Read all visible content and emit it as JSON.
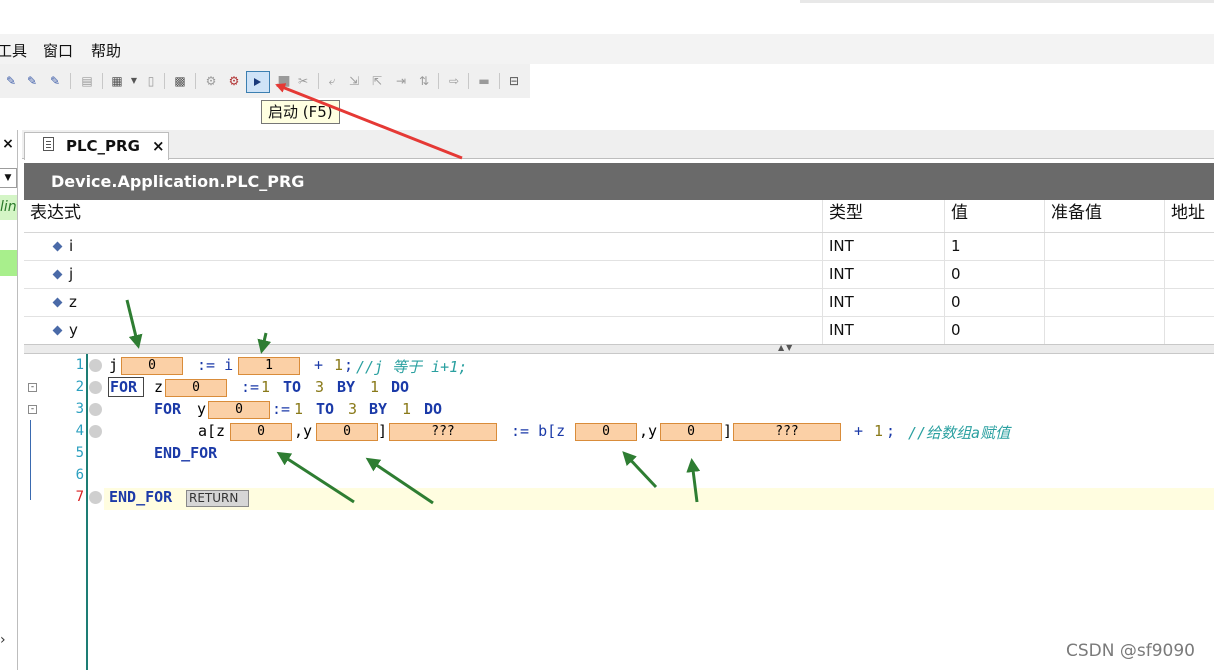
{
  "menu": {
    "tools": "工具",
    "window": "窗口",
    "help": "帮助"
  },
  "toolbar": {
    "run_tooltip": "启动 (F5)",
    "icons": [
      "login-icon",
      "logout-icon",
      "online-icon",
      "copy-icon",
      "add-device-icon",
      "paste-icon",
      "screenshot-icon",
      "build-icon",
      "rebuild-icon",
      "run-icon",
      "stop-icon",
      "reset-icon",
      "step-over-icon",
      "step-into-icon",
      "step-out-icon",
      "run-to-cursor-icon",
      "set-next-icon",
      "show-next-icon",
      "write-values-icon",
      "force-values-icon"
    ]
  },
  "left_panel": {
    "close": "×",
    "green_text": "lin",
    "chevron": "›"
  },
  "tab": {
    "label": "PLC_PRG",
    "close": "×"
  },
  "path": "Device.Application.PLC_PRG",
  "watch": {
    "headers": [
      "表达式",
      "类型",
      "值",
      "准备值",
      "地址"
    ],
    "rows": [
      {
        "expr": "i",
        "type": "INT",
        "value": "1",
        "prepared": "",
        "address": ""
      },
      {
        "expr": "j",
        "type": "INT",
        "value": "0",
        "prepared": "",
        "address": ""
      },
      {
        "expr": "z",
        "type": "INT",
        "value": "0",
        "prepared": "",
        "address": ""
      },
      {
        "expr": "y",
        "type": "INT",
        "value": "0",
        "prepared": "",
        "address": ""
      }
    ]
  },
  "editor": {
    "line_numbers": [
      "1",
      "2",
      "3",
      "4",
      "5",
      "6",
      "7"
    ],
    "l1": {
      "j": "j",
      "j_val": "0",
      "assign": ":= i",
      "i_val": "1",
      "plus": "+",
      "one": "1",
      "semi": ";",
      "comment": "//j 等于 i+1;"
    },
    "l2": {
      "for": "FOR",
      "z": "z",
      "z_val": "0",
      "assign": ":=",
      "from": "1",
      "to": "TO",
      "to_val": "3",
      "by": "BY",
      "by_val": "1",
      "do": "DO"
    },
    "l3": {
      "for": "FOR",
      "y": "y",
      "y_val": "0",
      "assign": ":=",
      "from": "1",
      "to": "TO",
      "to_val": "3",
      "by": "BY",
      "by_val": "1",
      "do": "DO"
    },
    "l4": {
      "a": "a[z",
      "az_val": "0",
      "comma1": ",y",
      "ay_val": "0",
      "rb1": "]",
      "a_val": "???",
      "assign": ":= b[z",
      "bz_val": "0",
      "comma2": ",y",
      "by_val": "0",
      "rb2": "]",
      "b_val": "???",
      "plus": "+",
      "one": "1",
      "semi": ";",
      "comment": "//给数组a赋值"
    },
    "l5": {
      "end_for": "END_FOR"
    },
    "l7": {
      "end_for": "END_FOR",
      "ret": "RETURN"
    }
  },
  "watermark": "CSDN @sf9090",
  "colors": {
    "arrow_red": "#e53935",
    "arrow_green": "#2e7d32",
    "monitor_bg": "#fbd0a6",
    "path_bar": "#6a6a6a"
  }
}
